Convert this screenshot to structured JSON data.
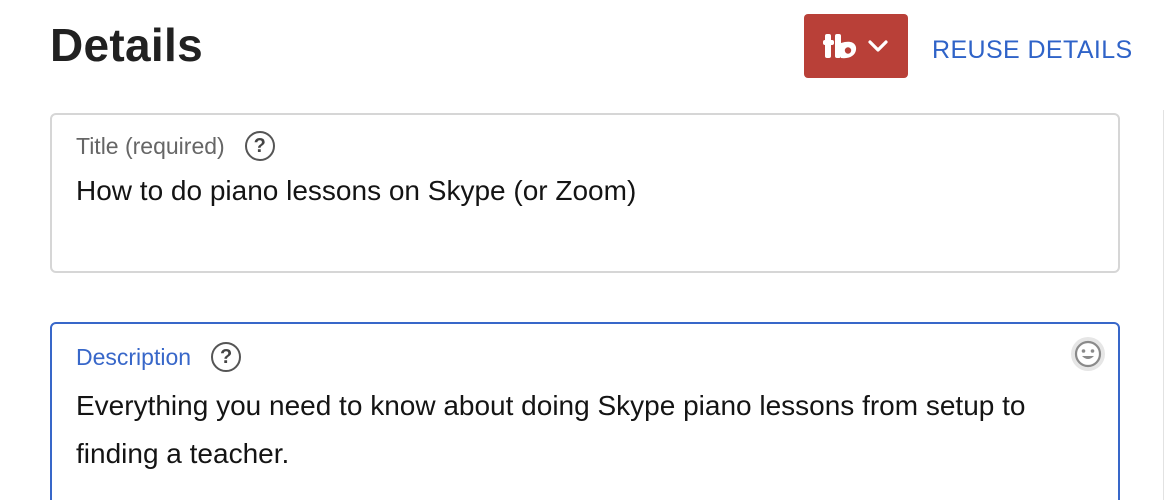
{
  "header": {
    "title": "Details",
    "reuse_label": "REUSE DETAILS",
    "tb_button_icon": "tubebuddy-icon",
    "tb_button_color": "#b94038"
  },
  "title_field": {
    "label": "Title (required)",
    "help_icon": "?",
    "value": "How to do piano lessons on Skype (or Zoom)"
  },
  "description_field": {
    "label": "Description",
    "help_icon": "?",
    "value": "Everything you need to know about doing Skype piano lessons from setup to finding a teacher.",
    "emoji_icon": "emoji-icon",
    "focus_color": "#3867c9"
  }
}
